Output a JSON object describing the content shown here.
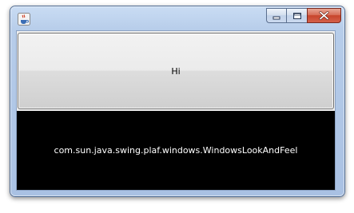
{
  "window": {
    "icon": "java-cup-icon",
    "caption_buttons": [
      "minimize-icon",
      "maximize-icon",
      "close-icon"
    ]
  },
  "content": {
    "button_label": "Hi",
    "look_and_feel_text": "com.sun.java.swing.plaf.windows.WindowsLookAndFeel"
  },
  "colors": {
    "label_background": "#000000",
    "label_text": "#ffffff",
    "close_button": "#c7452b"
  }
}
